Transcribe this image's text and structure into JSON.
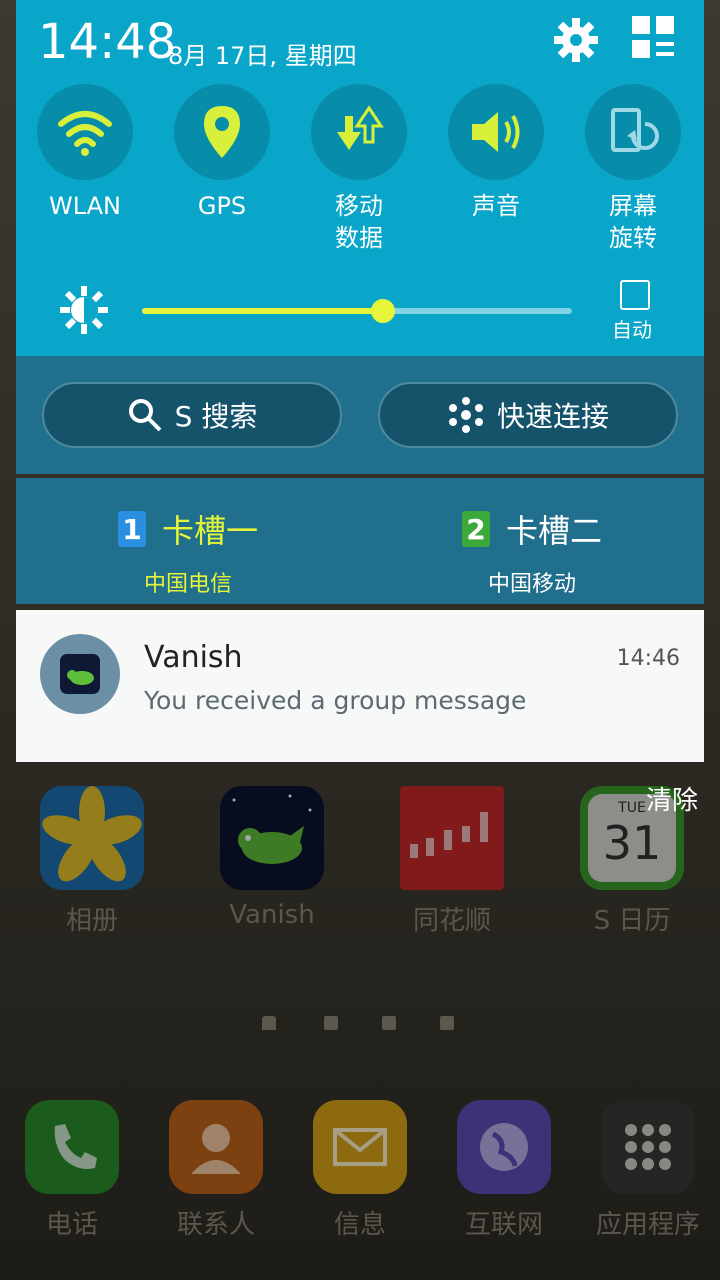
{
  "status": {
    "time": "14:48",
    "date": "8月 17日, 星期四"
  },
  "quick_settings": [
    {
      "label": "WLAN",
      "icon": "wifi-icon",
      "active": true
    },
    {
      "label": "GPS",
      "icon": "location-icon",
      "active": true
    },
    {
      "label": "移动\n数据",
      "icon": "mobile-data-icon",
      "active": true
    },
    {
      "label": "声音",
      "icon": "sound-icon",
      "active": true
    },
    {
      "label": "屏幕\n旋转",
      "icon": "rotate-icon",
      "active": false
    }
  ],
  "brightness": {
    "level": 0.56,
    "auto_label": "自动"
  },
  "actions": {
    "search_label": "S 搜索",
    "quick_connect_label": "快速连接"
  },
  "sims": [
    {
      "num": "1",
      "name": "卡槽一",
      "carrier": "中国电信",
      "color": "#e6f53a",
      "badge": "#2a8fe0"
    },
    {
      "num": "2",
      "name": "卡槽二",
      "carrier": "中国移动",
      "color": "#ffffff",
      "badge": "#3aa93a"
    }
  ],
  "notification": {
    "app": "Vanish",
    "message": "You received a group message",
    "time": "14:46"
  },
  "clear_label": "清除",
  "home_apps": [
    {
      "label": "相册"
    },
    {
      "label": "Vanish"
    },
    {
      "label": "同花顺"
    },
    {
      "label": "S 日历",
      "cal_day": "TUE",
      "cal_date": "31"
    }
  ],
  "dock": [
    {
      "label": "电话"
    },
    {
      "label": "联系人"
    },
    {
      "label": "信息"
    },
    {
      "label": "互联网"
    },
    {
      "label": "应用程序"
    }
  ]
}
